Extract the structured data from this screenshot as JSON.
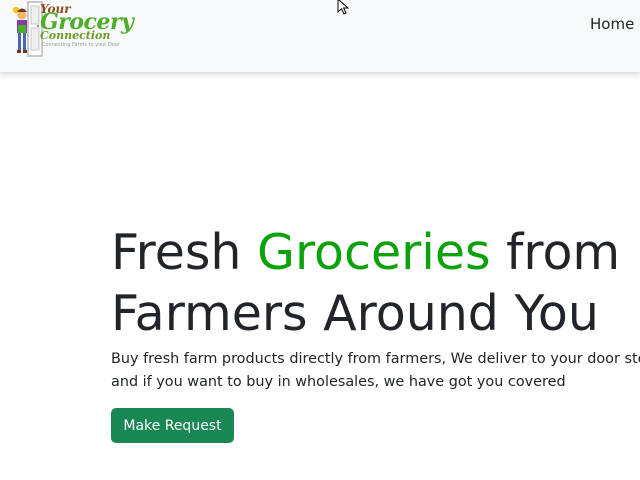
{
  "header": {
    "logo": {
      "line1": "Your",
      "line2": "Grocery",
      "line3": "Connection",
      "tagline": "Connecting Farms to your Door"
    },
    "nav": {
      "home_label": "Home"
    }
  },
  "hero": {
    "title_part1": "Fresh ",
    "title_highlight": "Groceries",
    "title_part2": " from",
    "title_line2": "Farmers Around You",
    "description": "Buy fresh farm products directly from farmers, We deliver to your door step and if you want to buy in wholesales, we have got you covered",
    "cta_label": "Make Request"
  },
  "colors": {
    "accent_green": "#0ca20c",
    "button_green": "#198754",
    "navbar_bg": "#f8f9fa",
    "text_dark": "#212529"
  },
  "icons": [
    "door-mascot-logo-icon",
    "mouse-cursor-icon"
  ]
}
